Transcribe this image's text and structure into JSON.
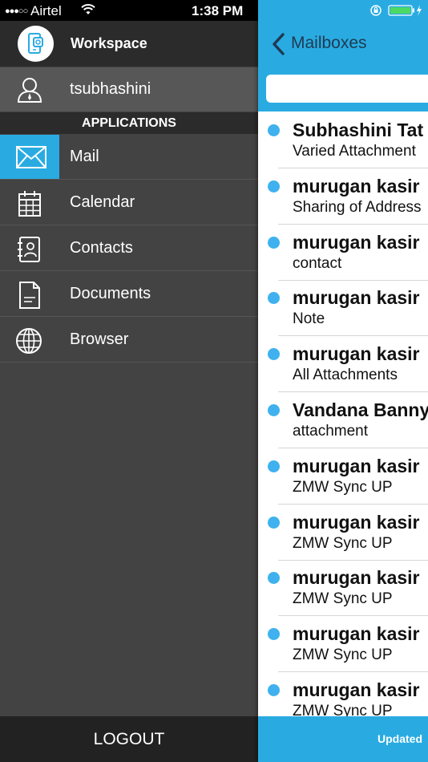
{
  "status_bar": {
    "carrier_dots": "●●●○○",
    "carrier": "Airtel",
    "time": "1:38 PM"
  },
  "drawer": {
    "app_title": "Workspace",
    "username": "tsubhashini",
    "section_header": "APPLICATIONS",
    "items": [
      {
        "label": "Mail",
        "icon": "mail-icon",
        "selected": true
      },
      {
        "label": "Calendar",
        "icon": "calendar-icon",
        "selected": false
      },
      {
        "label": "Contacts",
        "icon": "contacts-icon",
        "selected": false
      },
      {
        "label": "Documents",
        "icon": "document-icon",
        "selected": false
      },
      {
        "label": "Browser",
        "icon": "globe-icon",
        "selected": false
      }
    ],
    "logout_label": "LOGOUT"
  },
  "mail": {
    "back_label": "Mailboxes",
    "rows": [
      {
        "sender": "Subhashini Tat",
        "subject": "Varied Attachment",
        "unread": true
      },
      {
        "sender": "murugan kasir",
        "subject": "Sharing of Address",
        "unread": true
      },
      {
        "sender": "murugan kasir",
        "subject": "contact",
        "unread": true
      },
      {
        "sender": "murugan kasir",
        "subject": "Note",
        "unread": true
      },
      {
        "sender": "murugan kasir",
        "subject": "All Attachments",
        "unread": true
      },
      {
        "sender": "Vandana Banny",
        "subject": "attachment",
        "unread": true
      },
      {
        "sender": "murugan kasir",
        "subject": "ZMW Sync UP",
        "unread": true
      },
      {
        "sender": "murugan kasir",
        "subject": "ZMW Sync UP",
        "unread": true
      },
      {
        "sender": "murugan kasir",
        "subject": "ZMW Sync UP",
        "unread": true
      },
      {
        "sender": "murugan kasir",
        "subject": "ZMW Sync UP",
        "unread": true
      },
      {
        "sender": "murugan kasir",
        "subject": "ZMW Sync UP",
        "unread": true
      }
    ],
    "footer_text": "Updated"
  },
  "colors": {
    "accent": "#29abe2",
    "unread_dot": "#3fb1ee",
    "drawer_bg": "#434343",
    "header_bg": "#2b2b2b"
  }
}
